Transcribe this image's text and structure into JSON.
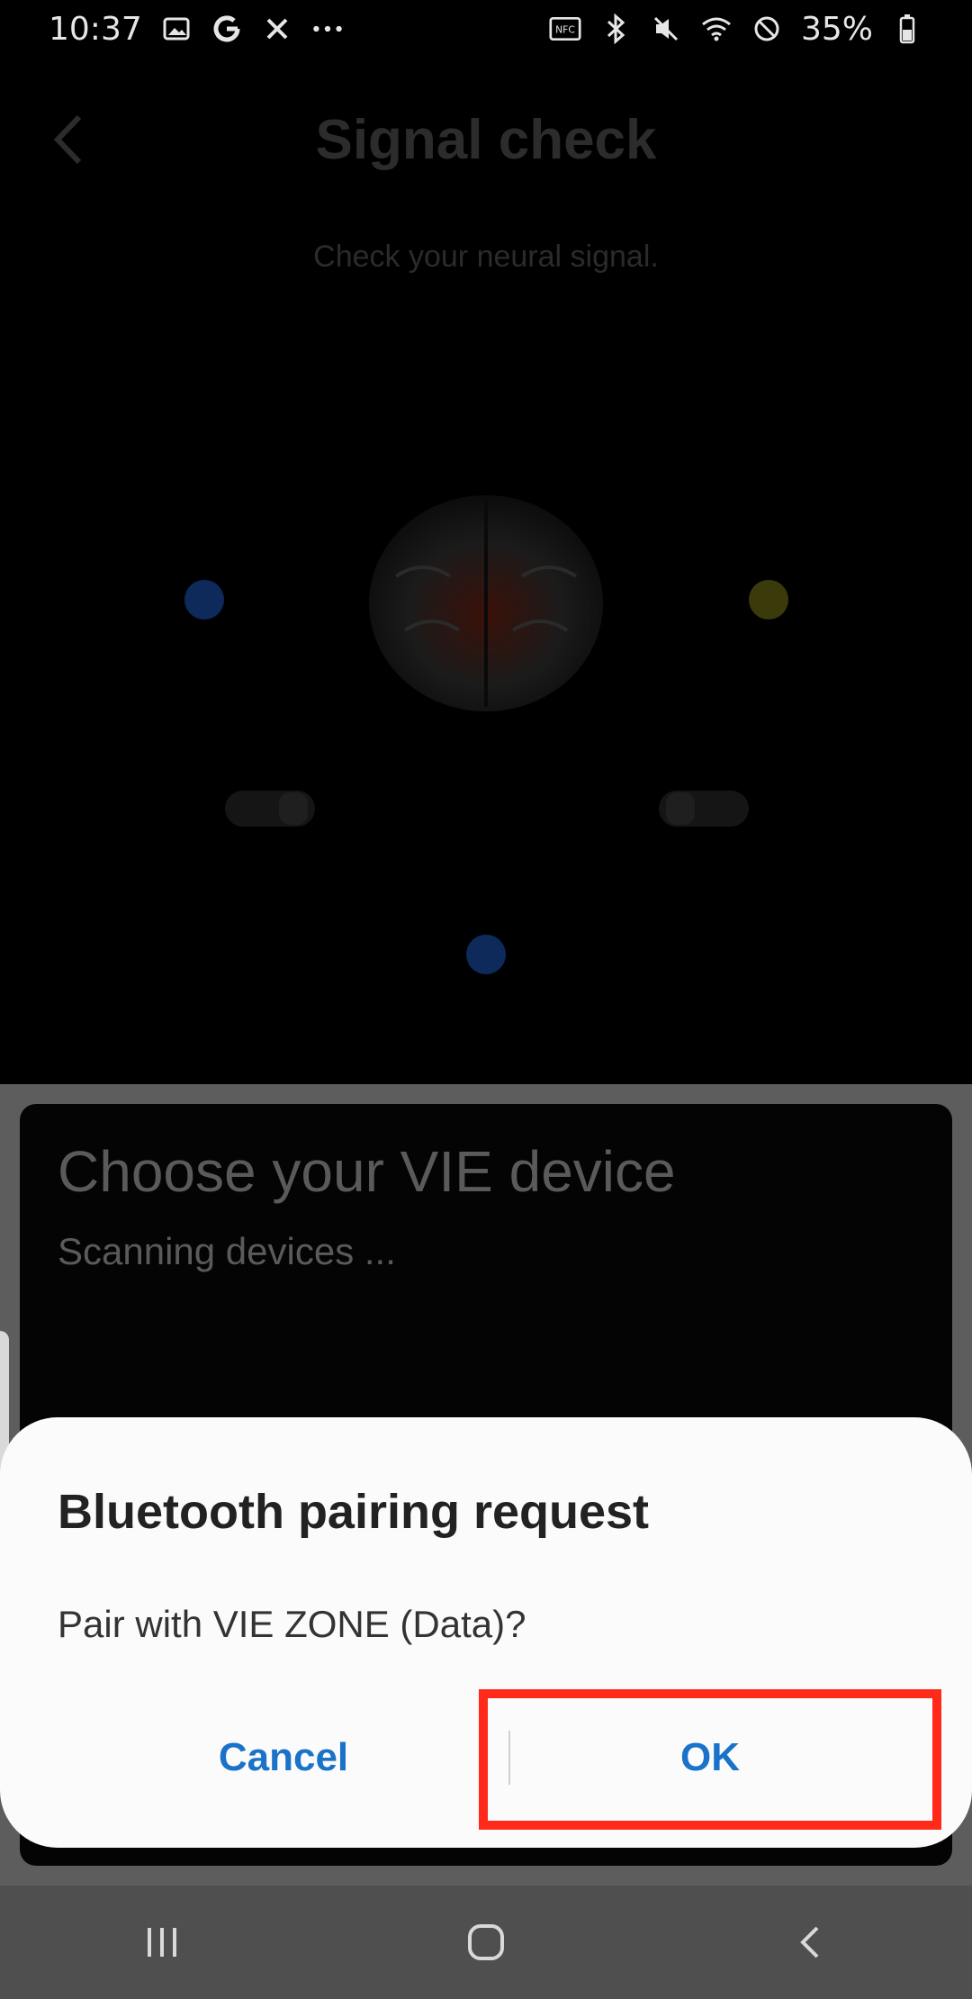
{
  "status_bar": {
    "time": "10:37",
    "left_icons": [
      "gallery-icon",
      "google-g-icon",
      "tools-icon",
      "more-dots-icon"
    ],
    "right_icons": [
      "nfc-icon",
      "bluetooth-icon",
      "mute-icon",
      "wifi-icon",
      "do-not-disturb-icon",
      "battery-icon"
    ],
    "battery_text": "35%"
  },
  "app": {
    "title": "Signal check",
    "subtitle": "Check your neural signal."
  },
  "device_picker": {
    "title": "Choose your VIE device",
    "status": "Scanning devices ..."
  },
  "dialog": {
    "title": "Bluetooth pairing request",
    "message": "Pair with VIE ZONE (Data)?",
    "cancel_label": "Cancel",
    "ok_label": "OK",
    "accent_color": "#1a73c8"
  },
  "highlight_color": "#ff2a1a",
  "navbar": {
    "recent_icon": "recent-apps-icon",
    "home_icon": "home-icon",
    "back_icon": "back-icon"
  }
}
